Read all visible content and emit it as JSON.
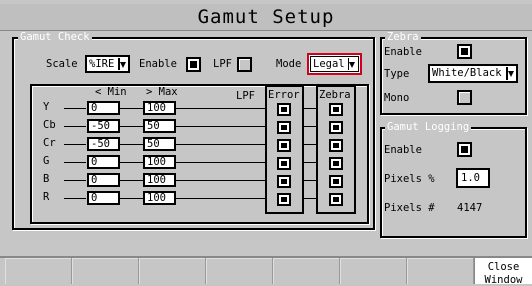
{
  "window": {
    "title": "Gamut Setup"
  },
  "gamut_check": {
    "legend": "Gamut Check",
    "scale_label": "Scale",
    "scale_value": "%IRE",
    "enable_label": "Enable",
    "enable_checked": true,
    "lpf_label": "LPF",
    "lpf_checked": false,
    "mode_label": "Mode",
    "mode_value": "Legal",
    "min_header": "< Min",
    "max_header": "> Max",
    "lpf_col_header": "LPF",
    "error_header": "Error",
    "zebra_header": "Zebra",
    "rows": [
      {
        "label": "Y",
        "min": "0",
        "max": "100"
      },
      {
        "label": "Cb",
        "min": "-50",
        "max": "50"
      },
      {
        "label": "Cr",
        "min": "-50",
        "max": "50"
      },
      {
        "label": "G",
        "min": "0",
        "max": "100"
      },
      {
        "label": "B",
        "min": "0",
        "max": "100"
      },
      {
        "label": "R",
        "min": "0",
        "max": "100"
      }
    ]
  },
  "zebra": {
    "legend": "Zebra",
    "enable_label": "Enable",
    "enable_checked": true,
    "type_label": "Type",
    "type_value": "White/Black",
    "mono_label": "Mono",
    "mono_checked": false
  },
  "gamut_logging": {
    "legend": "Gamut Logging",
    "enable_label": "Enable",
    "enable_checked": true,
    "pixels_pct_label": "Pixels %",
    "pixels_pct_value": "1.0",
    "pixels_count_label": "Pixels #",
    "pixels_count_value": "4147"
  },
  "softkeys": {
    "close_window_label": "Close Window"
  },
  "colors": {
    "mode_highlight": "#d0021b",
    "background": "#c6c6c6"
  }
}
